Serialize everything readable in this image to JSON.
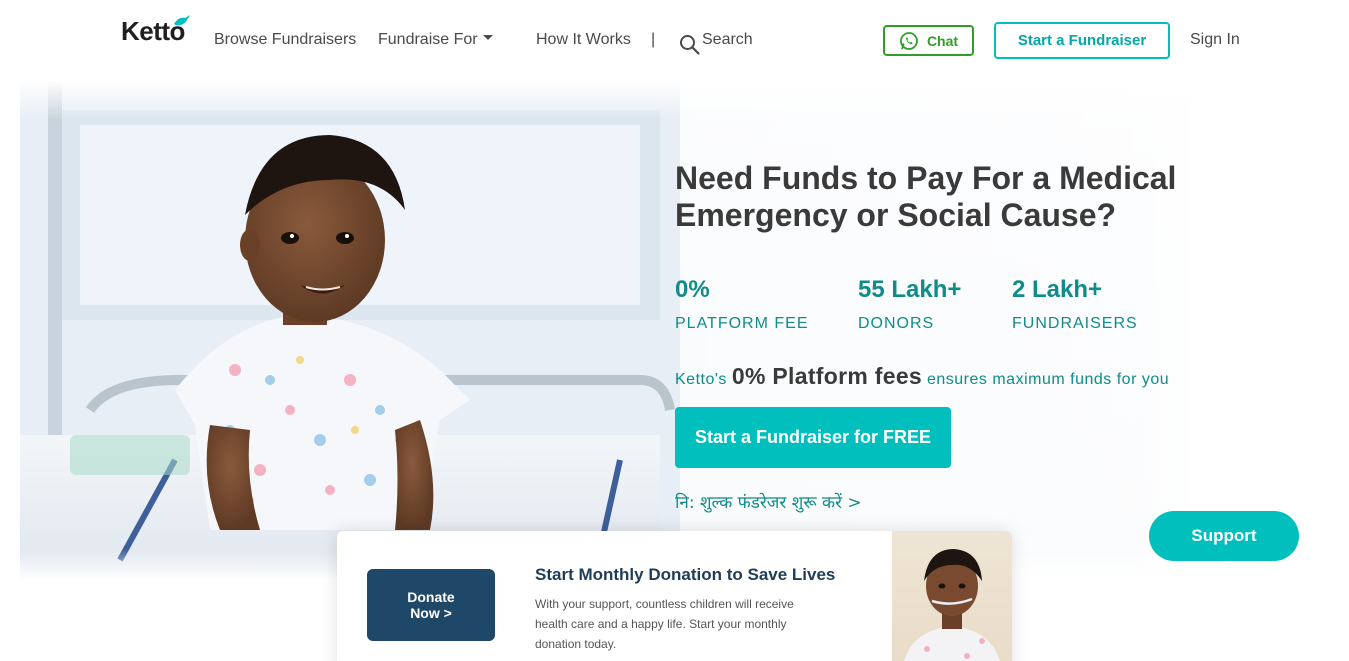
{
  "header": {
    "logo_text": "Ketto",
    "nav": {
      "browse": "Browse Fundraisers",
      "fundraise_for": "Fundraise For",
      "how_it_works": "How It Works",
      "divider": "|",
      "search": "Search"
    },
    "chat_label": "Chat",
    "start_label": "Start a Fundraiser",
    "signin_label": "Sign In"
  },
  "hero": {
    "title": "Need Funds to Pay For a Medical Emergency or Social Cause?",
    "stats": [
      {
        "value": "0%",
        "label": "PLATFORM FEE"
      },
      {
        "value": "55 Lakh+",
        "label": "DONORS"
      },
      {
        "value": "2 Lakh+",
        "label": "FUNDRAISERS"
      }
    ],
    "fee_prefix": "Ketto's",
    "fee_highlight": "0% Platform fees",
    "fee_suffix": "ensures maximum funds for you",
    "cta_label": "Start a Fundraiser for FREE",
    "hindi_link": "नि: शुल्क फंडरेजर शुरू करें >"
  },
  "support_label": "Support",
  "monthly": {
    "donate_label": "Donate Now >",
    "title": "Start Monthly Donation to Save Lives",
    "description": "With your support, countless children will receive health care and a happy life. Start your monthly donation today."
  },
  "colors": {
    "accent": "#01bfbd",
    "teal_text": "#0f8c8a",
    "whatsapp_green": "#2f9e27",
    "navy": "#1f4868"
  },
  "icons": [
    "ketto-bird-icon",
    "caret-down-icon",
    "search-icon",
    "whatsapp-icon"
  ]
}
